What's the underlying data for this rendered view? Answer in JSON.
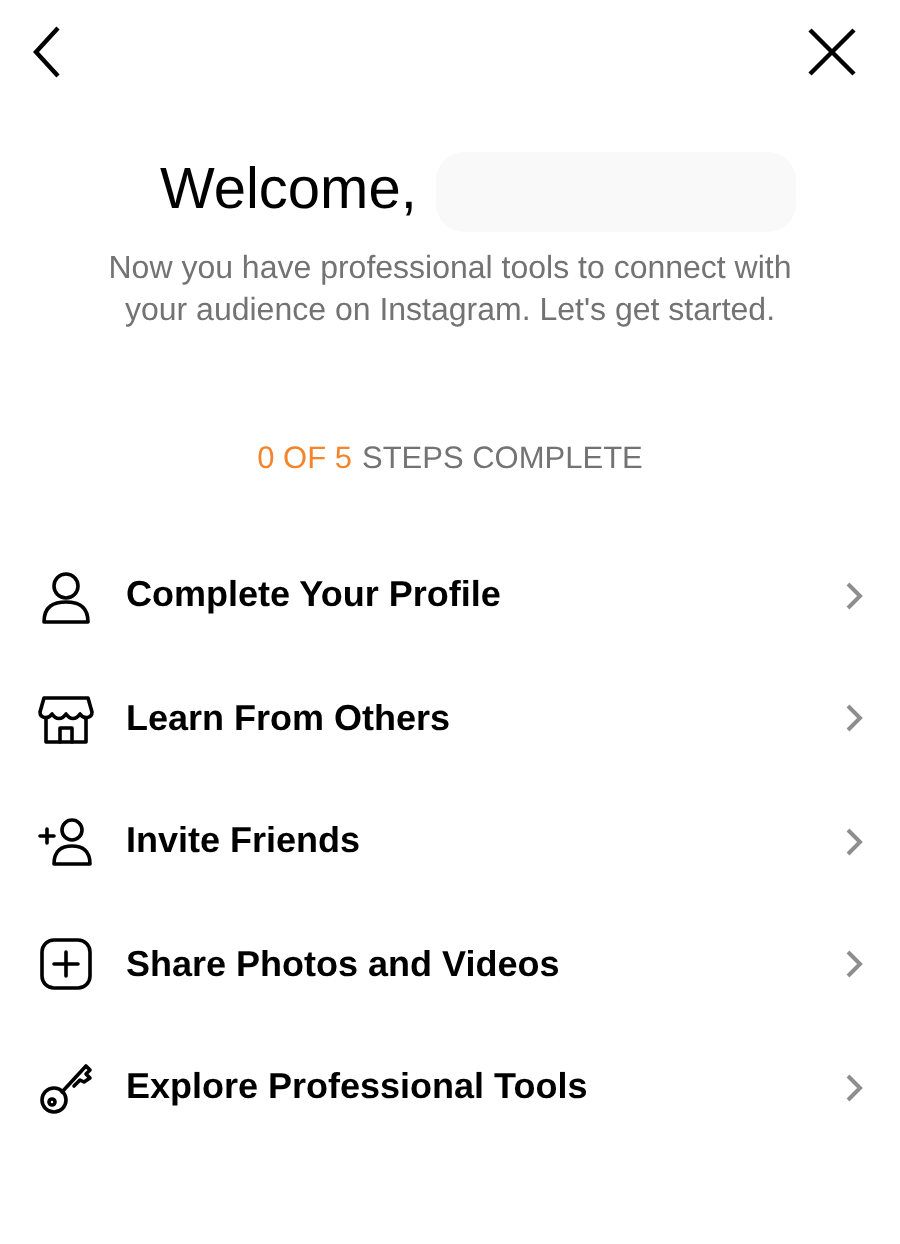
{
  "header": {
    "title": "Welcome,",
    "subtitle": "Now you have professional tools to connect with your audience on Instagram. Let's get started."
  },
  "progress": {
    "count": "0 OF 5",
    "label": "STEPS COMPLETE"
  },
  "steps": [
    {
      "kind": "profile",
      "label": "Complete Your Profile"
    },
    {
      "kind": "shop",
      "label": "Learn From Others"
    },
    {
      "kind": "invite",
      "label": "Invite Friends"
    },
    {
      "kind": "create",
      "label": "Share Photos and Videos"
    },
    {
      "kind": "key",
      "label": "Explore Professional Tools"
    }
  ]
}
